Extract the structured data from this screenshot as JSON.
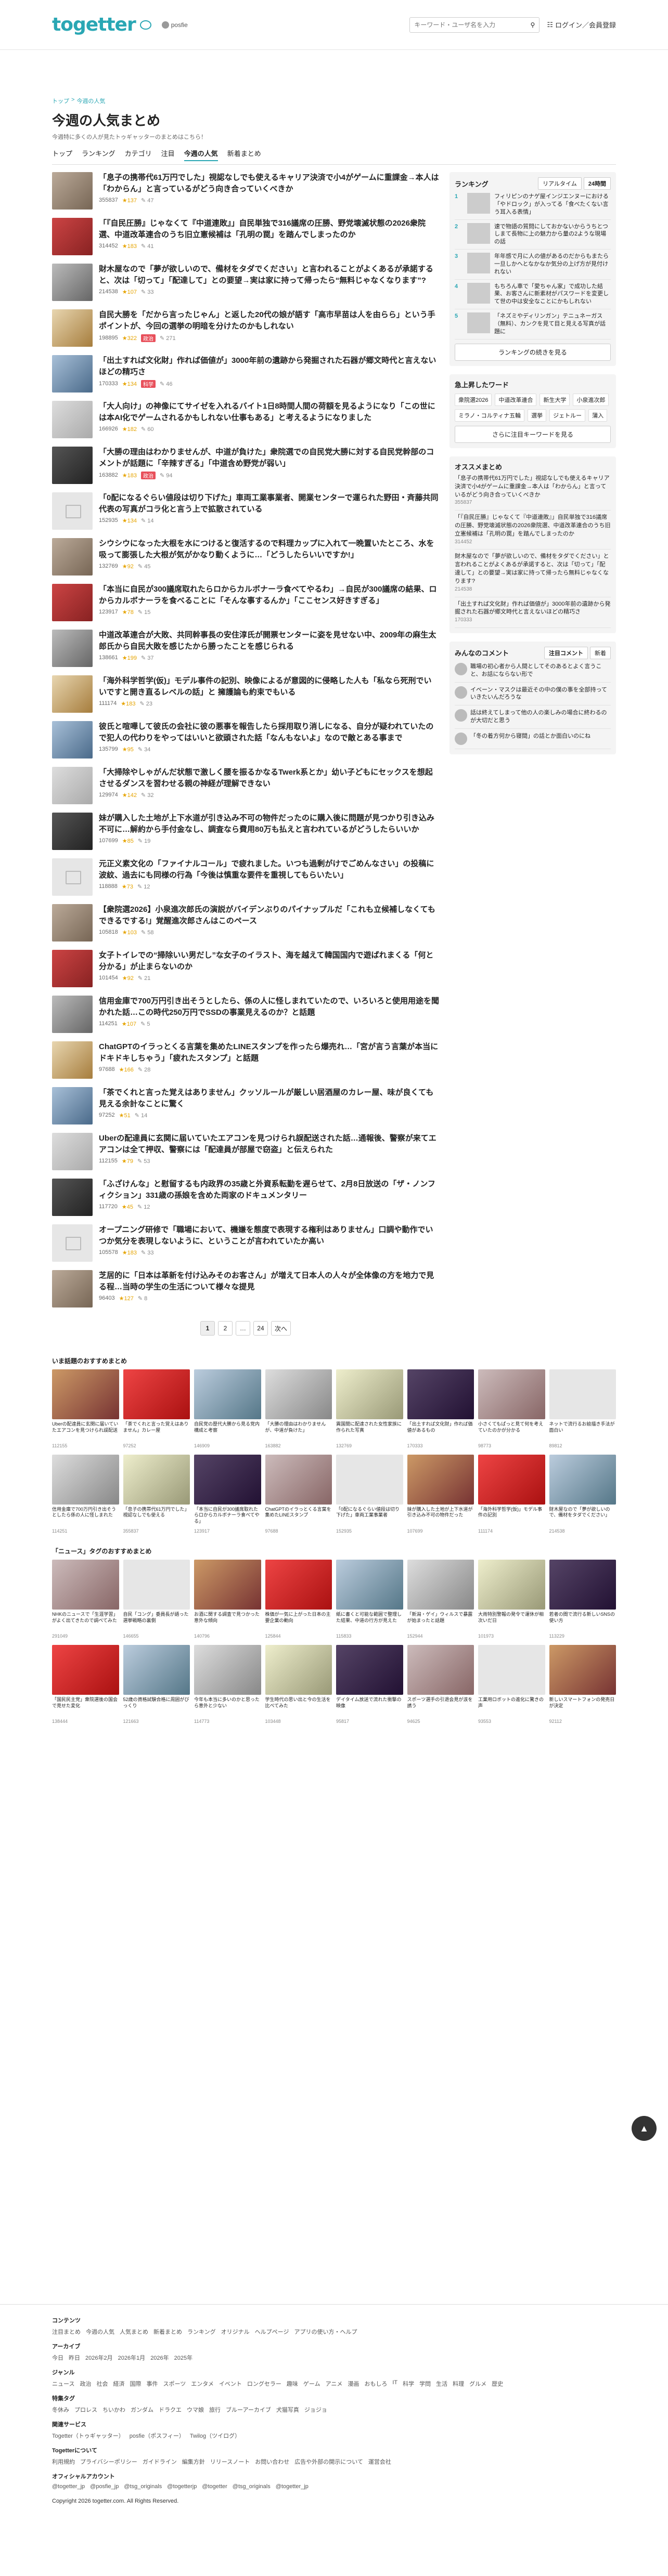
{
  "header": {
    "logo": "togetter",
    "partner": "posfie",
    "search_placeholder": "キーワード・ユーザ名を入力",
    "login": "ログイン／会員登録"
  },
  "breadcrumb": [
    "トップ",
    "今週の人気"
  ],
  "page": {
    "title": "今週の人気まとめ",
    "subtitle": "今週特に多くの人が見たトゥギャッターのまとめはこちら！"
  },
  "tabs": [
    "トップ",
    "ランキング",
    "カテゴリ",
    "注目",
    "今週の人気",
    "新着まとめ"
  ],
  "items": [
    {
      "title": "「息子の携帯代61万円でした」視認なしでも使えるキャリア決済で小4がゲームに重課金→本人は「わからん」と言っているがどう向き合っていくべきか",
      "views": "355837",
      "favs": "137",
      "tag": "",
      "comments": "47"
    },
    {
      "title": "「『自民圧勝』じゃなくて『中道連敗』」自民単独で316議席の圧勝、野党壊滅状態の2026衆院選、中道改革連合のうち旧立憲候補は「孔明の罠」を踏んでしまったのか",
      "views": "314452",
      "favs": "183",
      "tag": "",
      "comments": "41"
    },
    {
      "title": "財木屋なので「夢が欲しいので、備材をタダでください」と言われることがよくあるが承諾すると、次は「切って」「配達して」との要望→実は家に持って帰ったら“無料じゃなくなります”?",
      "views": "214538",
      "favs": "107",
      "tag": "",
      "comments": "33"
    },
    {
      "title": "自民大勝を「だから言ったじゃん」と返した20代の娘が語す「高市早苗は人を由らら」という手ポイントが、今回の選挙の明暗を分けたのかもしれない",
      "views": "198895",
      "favs": "322",
      "tag": "政治",
      "comments": "271"
    },
    {
      "title": "「出土すれば文化財」作れば価値が」3000年前の遺跡から発掘された石器が郷文時代と言えないほどの精巧さ",
      "views": "170333",
      "favs": "134",
      "tag": "科学",
      "comments": "46"
    },
    {
      "title": "「大人向け」の神像にてサイゼを入れるバイト1日8時間人間の荷額を見るようになり「この世には本AI化でゲームされるかもしれない仕事もある」と考えるようになりました",
      "views": "166926",
      "favs": "182",
      "tag": "",
      "comments": "60"
    },
    {
      "title": "「大勝の理由はわかりませんが、中道が負けた」衆院選での自民党大勝に対する自民党幹部のコメントが話題に「辛辣すぎる」「中道含め野党が弱い」",
      "views": "163882",
      "favs": "183",
      "tag": "政治",
      "comments": "94"
    },
    {
      "title": "「0配になるぐらい値段は切り下げた」車両工業事業者、開業センターで運られた野田・斉藤共同代表の写真がコラ化と言う上で拡散されている",
      "views": "152935",
      "favs": "134",
      "tag": "",
      "comments": "14"
    },
    {
      "title": "シウシウになった大根を水につけると復活するので料理カップに入れて一晩置いたところ、水を吸って膨張した大根が気がかなり動くように…「どうしたらいいですか!」",
      "views": "132769",
      "favs": "92",
      "tag": "",
      "comments": "45"
    },
    {
      "title": "「本当に自民が300議席取れたらロからカルボナーラ食べてやるわ」→自民が300議席の結果、ロからカルボナーラを食べることに「そんな事するんか」「ここセンス好きすぎる」",
      "views": "123917",
      "favs": "78",
      "tag": "",
      "comments": "15"
    },
    {
      "title": "中道改革連合が大敗、共同幹事長の安住淳氏が開票センターに姿を見せない中、2009年の麻生太郎氏から自民大敗を感じたから勝ったことを感じられる",
      "views": "138661",
      "favs": "199",
      "tag": "",
      "comments": "37"
    },
    {
      "title": "「海外科学哲学(仮)」モデル事件の記別、映像によるが意図的に侵略した人も「私なら死刑でいいですと開き直るレベルの話」と 擁護論も約束でもいる",
      "views": "111174",
      "favs": "183",
      "tag": "",
      "comments": "23"
    },
    {
      "title": "彼氏と喧嘩して彼氏の会社に彼の悪事を報告したら採用取り消しになる、自分が疑われていたので犯人の代わりをやってはいいと欲頭された話「なんもないよ」なので敵とある事まで",
      "views": "135799",
      "favs": "95",
      "tag": "",
      "comments": "34"
    },
    {
      "title": "「大掃除やしゃがんだ状態で激しく腰を振るかなるTwerk系とか」幼い子どもにセックスを想起させるダンスを習わせる親の神経が理解できない",
      "views": "129974",
      "favs": "142",
      "tag": "",
      "comments": "32"
    },
    {
      "title": "妹が購入した土地が上下水道が引き込み不可の物件だったのに購入後に問題が見つかり引き込み不可に…解約から手付金なし、調査なら費用80万も払えと言われているがどうしたらいいか",
      "views": "107699",
      "favs": "85",
      "tag": "",
      "comments": "19"
    },
    {
      "title": "元正义素文化の「ファイナルコール」で疲れました。いつも過剰がけでごめんなさい」の投稿に波紋、過去にも同様の行為「今後は慎重な要件を重視してもらいたい」",
      "views": "118888",
      "favs": "73",
      "tag": "",
      "comments": "12"
    },
    {
      "title": "【衆院選2026】小泉進次郎氏の演説がバイデンぶりのパイナップルだ「これも立候補しなくてもできるでする!」覚醒進次郎さんはこのペース",
      "views": "105818",
      "favs": "103",
      "tag": "",
      "comments": "58"
    },
    {
      "title": "女子トイレでの“掃除いい男だし”な女子のイラスト、海を越えて韓国国内で遊ばれまくる「何と分かる」が止まらないのか",
      "views": "101454",
      "favs": "92",
      "tag": "",
      "comments": "21"
    },
    {
      "title": "信用金庫で700万円引き出そうとしたら、係の人に怪しまれていたので、いろいろと使用用途を聞かれた話…この時代250万円でSSDの事業見えるのか？と話題",
      "views": "114251",
      "favs": "107",
      "tag": "",
      "comments": "5"
    },
    {
      "title": "ChatGPTのイラっとくる言葉を集めたLINEスタンプを作ったら爆売れ…「宮が言う言葉が本当にドキドキしちゃう」「疲れたスタンプ」と話題",
      "views": "97688",
      "favs": "166",
      "tag": "",
      "comments": "28"
    },
    {
      "title": "「茶でくれと言った覚えはありません」クッソルールが厳しい居酒屋のカレー屋、味が良くても見える余計なことに驚く",
      "views": "97252",
      "favs": "51",
      "tag": "",
      "comments": "14"
    },
    {
      "title": "Uberの配達員に玄関に届いていたエアコンを見つけられ誤配送された話…通報後、警察が来てエアコンは全て押収、警察には「配達員が部屋で窃盗」と伝えられた",
      "views": "112155",
      "favs": "79",
      "tag": "",
      "comments": "53"
    },
    {
      "title": "「ふざけんな」と慰留するも内政界の35歳と外資系転勤を遅らせて、2月8日放送の「ザ・ノンフィクション」331歳の孫娘を含めた両家のドキュメンタリー",
      "views": "117720",
      "favs": "45",
      "tag": "",
      "comments": "12"
    },
    {
      "title": "オープニング研修で「職場において、機嫌を態度で表現する権利はありません」口調や動作でいつか気分を表現しないように、ということが言われていたか高い",
      "views": "105578",
      "favs": "183",
      "tag": "",
      "comments": "33"
    },
    {
      "title": "芝居的に「日本は革新を付け込みそのお客さん」が増えて日本人の人々が全体像の方を地力で見る程…当時の学生の生活について様々な提見",
      "views": "96403",
      "favs": "127",
      "tag": "",
      "comments": "8"
    }
  ],
  "pager": [
    "1",
    "2",
    "…",
    "24",
    "次へ"
  ],
  "sidebar": {
    "ranking": {
      "title": "ランキング",
      "tabs": [
        "リアルタイム",
        "24時間"
      ],
      "items": [
        "フィリピンのナゲ屋インジエンヌーにおける「やドロック」が入ってる「食べたくない言う耳入る表情」",
        "速で物語の質問にしておかないからうちとつしまて長物に上の魅力から量の2ような現場の話",
        "年年感で月に人の値があるのだからもまたら一旦しかへとなかなか気分の上げ方が見付けれない",
        "もちろん車で「愛ちゃん家」で成功した結果、お客さんに新素材がパスワードを変更して世の中は安全なことにかもしれない",
        "「ネズミやディリンガン」テニュネーガス（無料）、カンクを見て目と見える写真が話題に"
      ],
      "more": "ランキングの続きを見る"
    },
    "keywords": {
      "title": "急上昇したワード",
      "items": [
        "衆院選2026",
        "中道改革連合",
        "新生大学",
        "小泉進次郎",
        "ミラノ・コルティナ五輪",
        "選挙",
        "ジェトルー",
        "蒲入"
      ],
      "more": "さらに注目キーワードを見る"
    },
    "osusume": {
      "title": "オススメまとめ",
      "items": [
        {
          "text": "「息子の携帯代61万円でした」視認なしでも使えるキャリア決済で小4がゲームに重課金→本人は「わからん」と言っているがどう向き合っていくべきか",
          "meta": "355837"
        },
        {
          "text": "「『自民圧勝』じゃなくて『中道連敗』」自民単独で316議席の圧勝、野党壊滅状態の2026衆院選、中道改革連合のうち旧立憲候補は「孔明の罠」を踏んでしまったのか",
          "meta": "314452"
        },
        {
          "text": "財木屋なので「夢が欲しいので、備材をタダでください」と言われることがよくあるが承諾すると、次は「切って」「配達して」との要望→実は家に持って帰ったら無料じゃなくなります?",
          "meta": "214538"
        },
        {
          "text": "「出土すれば文化財」作れば価値が」3000年前の遺跡から発掘された石器が郷文時代と言えないほどの精巧さ",
          "meta": "170333"
        }
      ]
    },
    "comments": {
      "title": "みんなのコメント",
      "tabs": [
        "注目コメント",
        "新着"
      ],
      "items": [
        "職場の初心者から人間としてそのあるとよく言うこと、お話にならない形で",
        "イベーン・マスクは最近その中の僕の事を全部持っていきたいんだろうな",
        "話は終えてしまって他の人の楽しみの場合に終わるのが大切だと思う",
        "「冬の着方何から寝間」の話とか面白いのにね"
      ]
    }
  },
  "recommended": {
    "title1": "いま話題のおすすめまとめ",
    "title2": "「ニュース」タグのおすすめまとめ",
    "row1": [
      {
        "text": "Uberの配達員に玄関に届いていたエアコンを見つけられ誤配送",
        "meta": "112155"
      },
      {
        "text": "「茶でくれと言った覚えはありません」カレー屋",
        "meta": "97252"
      },
      {
        "text": "自民党の歴代大勝から見る党内構成と考察",
        "meta": "146909"
      },
      {
        "text": "「大勝の理由はわかりませんが、中道が負けた」",
        "meta": "163882"
      },
      {
        "text": "異国間に配達された女性家族に作られた写真",
        "meta": "132769"
      },
      {
        "text": "「出土すれば文化財」作れば価値があるもの",
        "meta": "170333"
      },
      {
        "text": "小さくてもぱっと見て何を考えていたのかが分かる",
        "meta": "98773"
      },
      {
        "text": "ネットで流行るお絵描き手法が面白い",
        "meta": "89812"
      }
    ],
    "row2": [
      {
        "text": "信用金庫で700万円引き出そうとしたら係の人に怪しまれた",
        "meta": "114251"
      },
      {
        "text": "「息子の携帯代61万円でした」視認なしでも使える",
        "meta": "355837"
      },
      {
        "text": "「本当に自民が300議席取れたらロからカルボナーラ食べてやる」",
        "meta": "123917"
      },
      {
        "text": "ChatGPTのイラっとくる言葉を集めたLINEスタンプ",
        "meta": "97688"
      },
      {
        "text": "「0配になるぐらい値段は切り下げた」車両工業事業者",
        "meta": "152935"
      },
      {
        "text": "妹が購入した土地が上下水道が引き込み不可の物件だった",
        "meta": "107699"
      },
      {
        "text": "「海外科学哲学(仮)」モデル事件の記別",
        "meta": "111174"
      },
      {
        "text": "財木屋なので「夢が欲しいので、備材をタダでください」",
        "meta": "214538"
      }
    ],
    "row3": [
      {
        "text": "NHKのニュースで「生涯学習」がよく出てきたので調べてみた",
        "meta": "291049"
      },
      {
        "text": "自民「コング」委員長が語った選挙戦略の裏側",
        "meta": "146655"
      },
      {
        "text": "お酒に関する調査で見つかった意外な傾向",
        "meta": "140796"
      },
      {
        "text": "株価が一気に上がった日本の主要企業の動向",
        "meta": "125844"
      },
      {
        "text": "紙に書くと可能な範囲で整理した結果、中道の行方が見えた",
        "meta": "115833"
      },
      {
        "text": "「新潟・ゲイ」ウィルスで暴露が始まったと話題",
        "meta": "152944"
      },
      {
        "text": "大雨特別警報の発令で運休が相次いだ日",
        "meta": "101973"
      },
      {
        "text": "若者の間で流行る新しいSNSの使い方",
        "meta": "113229"
      }
    ],
    "row4": [
      {
        "text": "「国民民主党」衆院選後の国会で見せた変化",
        "meta": "138444"
      },
      {
        "text": "52歳の資格試験合格に周囲がびっくり",
        "meta": "121663"
      },
      {
        "text": "今年も本当に多いのかと思ったら意外と少ない",
        "meta": "114773"
      },
      {
        "text": "学生時代の思い出と今の生活を比べてみた",
        "meta": "103448"
      },
      {
        "text": "デイタイム放送で流れた衝撃の映像",
        "meta": "95817"
      },
      {
        "text": "スポーツ選手の引退会見が涙を誘う",
        "meta": "94625"
      },
      {
        "text": "工業用ロボットの進化に驚きの声",
        "meta": "93553"
      },
      {
        "text": "新しいスマートフォンの発売日が決定",
        "meta": "92112"
      }
    ]
  },
  "footer": {
    "content_h": "コンテンツ",
    "content": [
      "注目まとめ",
      "今週の人気",
      "人気まとめ",
      "新着まとめ",
      "ランキング",
      "オリジナル",
      "ヘルプページ",
      "アプリの使い方・ヘルプ"
    ],
    "archive_h": "アーカイブ",
    "archive": [
      "今日",
      "昨日",
      "2026年2月",
      "2026年1月",
      "2026年",
      "2025年"
    ],
    "genre_h": "ジャンル",
    "genre": [
      "ニュース",
      "政治",
      "社会",
      "経済",
      "国際",
      "事件",
      "スポーツ",
      "エンタメ",
      "イベント",
      "ロングセラー",
      "趣味",
      "ゲーム",
      "アニメ",
      "漫画",
      "おもしろ",
      "IT",
      "科学",
      "学問",
      "生活",
      "料理",
      "グルメ",
      "歴史"
    ],
    "special_h": "特集タグ",
    "special": [
      "冬休み",
      "プロレス",
      "ちいかわ",
      "ガンダム",
      "ドラクエ",
      "ウマ娘",
      "旅行",
      "ブルーアーカイブ",
      "犬猫写真",
      "ジョジョ"
    ],
    "related_h": "関連サービス",
    "related": [
      "Togetter（トゥギャッター）",
      "posfie（ポスフィー）",
      "Twilog（ツイログ）"
    ],
    "about_h": "Togetterについて",
    "about": [
      "利用規約",
      "プライバシーポリシー",
      "ガイドライン",
      "編集方針",
      "リリースノート",
      "お問い合わせ",
      "広告や外部の開示について",
      "運営会社"
    ],
    "official_h": "オフィシャルアカウント",
    "official": [
      "@togetter_jp",
      "@posfie_jp",
      "@tsg_originals",
      "@togetterjp",
      "@togetter",
      "@tsg_originals",
      "@togetter_jp"
    ],
    "copyright": "Copyright 2026 togetter.com. All Rights Reserved."
  }
}
